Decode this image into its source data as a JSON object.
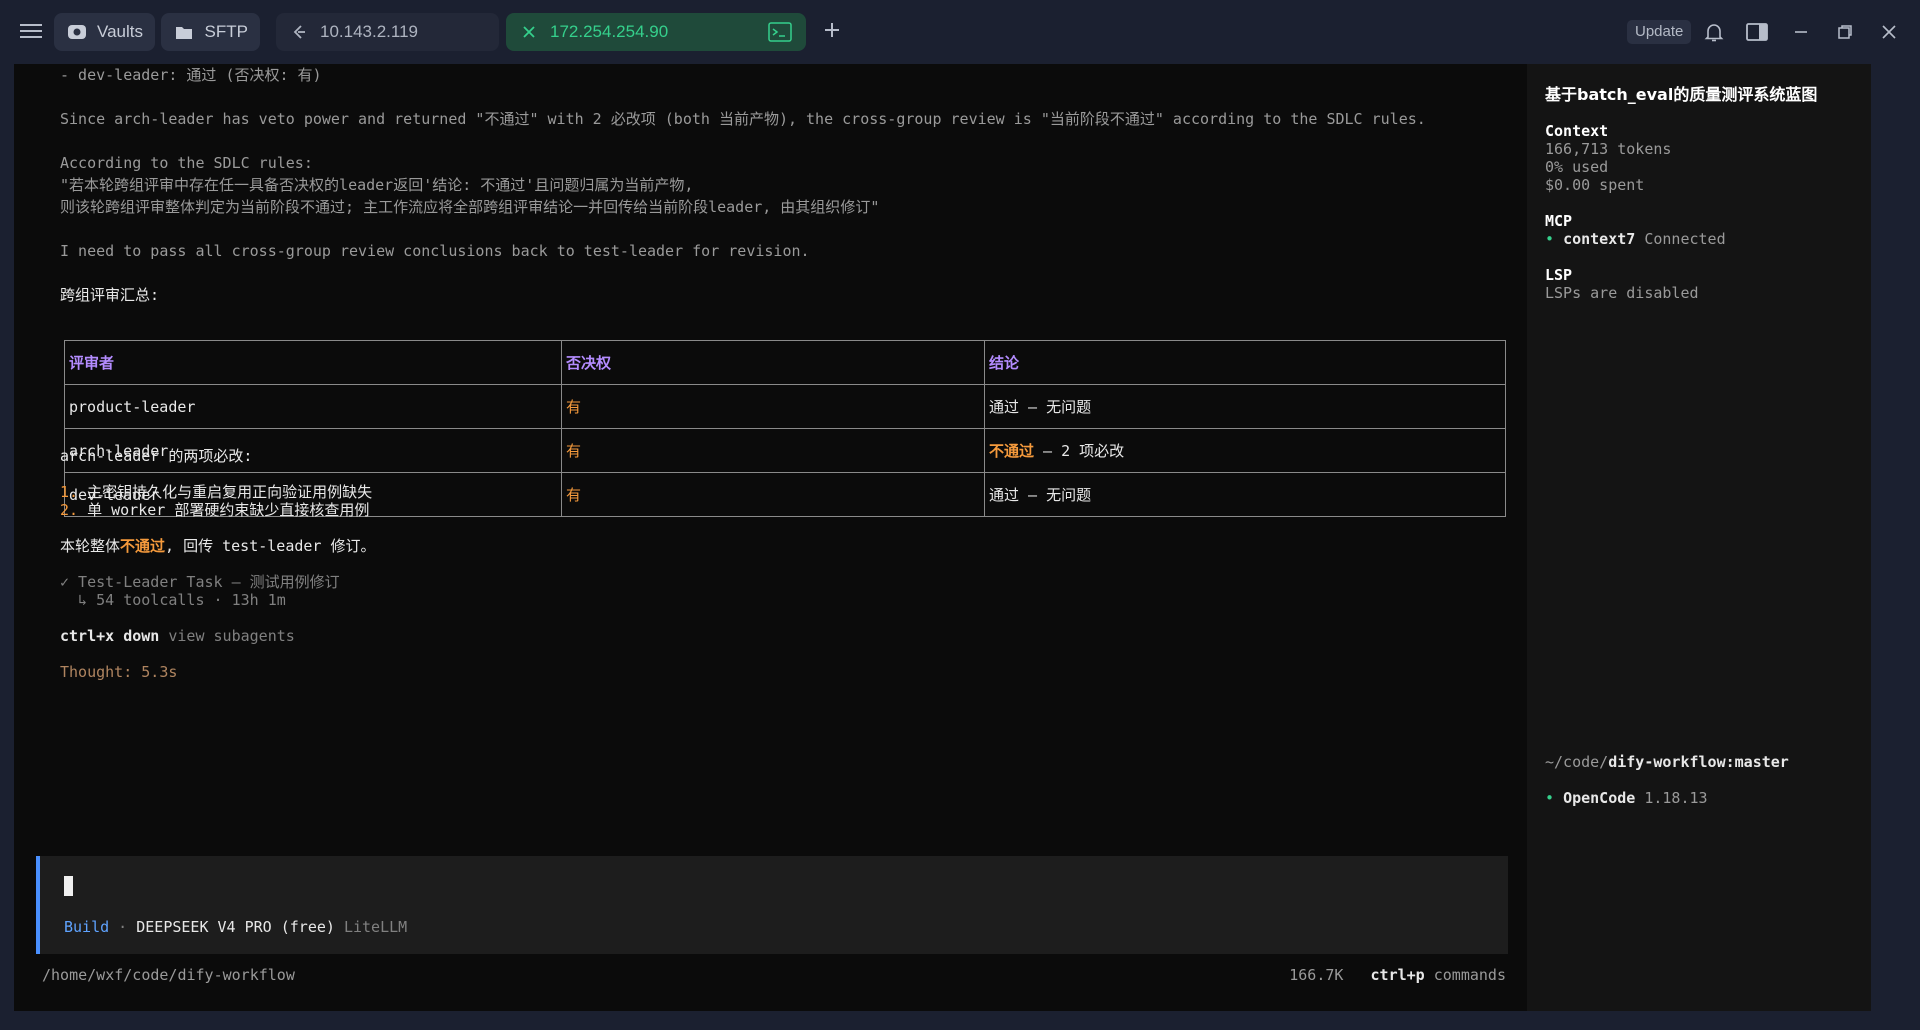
{
  "topbar": {
    "tabs": [
      {
        "label": "Vaults",
        "icon": "vault-icon"
      },
      {
        "label": "SFTP",
        "icon": "folder-icon"
      },
      {
        "label": "10.143.2.119",
        "icon": "host-icon"
      },
      {
        "label": "172.254.254.90",
        "icon": "close-icon"
      }
    ],
    "update_label": "Update"
  },
  "main": {
    "lines": {
      "l1": "- dev-leader: 通过 (否决权: 有)",
      "l2": "Since arch-leader has veto power and returned \"不通过\" with 2 必改项 (both 当前产物), the cross-group review is \"当前阶段不通过\" according to the SDLC rules.",
      "l3": "According to the SDLC rules:",
      "l4": "\"若本轮跨组评审中存在任一具备否决权的leader返回'结论: 不通过'且问题归属为当前产物,",
      "l5": "则该轮跨组评审整体判定为当前阶段不通过; 主工作流应将全部跨组评审结论一并回传给当前阶段leader, 由其组织修订\"",
      "l6": "I need to pass all cross-group review conclusions back to test-leader for revision.",
      "l7": "跨组评审汇总:"
    },
    "table": {
      "headers": [
        "评审者",
        "否决权",
        "结论"
      ],
      "rows": [
        {
          "reviewer": "product-leader",
          "veto": "有",
          "verdict_highlight": "",
          "verdict": "通过 — 无问题"
        },
        {
          "reviewer": "arch-leader",
          "veto": "有",
          "verdict_highlight": "不通过",
          "verdict": " — 2 项必改"
        },
        {
          "reviewer": "dev-leader",
          "veto": "有",
          "verdict_highlight": "",
          "verdict": "通过 — 无问题"
        }
      ]
    },
    "must_fix_title": "arch-leader 的两项必改:",
    "must_fix": [
      {
        "num": "1.",
        "text": " 主密钥持久化与重启复用正向验证用例缺失"
      },
      {
        "num": "2.",
        "text": " 单 worker 部署硬约束缺少直接核查用例"
      }
    ],
    "summary": {
      "pre": "本轮整体",
      "highlight": "不通过",
      "post": ", 回传 test-leader 修订。"
    },
    "task_line": "✓ Test-Leader Task — 测试用例修订",
    "task_sub": "  ↳ 54 toolcalls · 13h 1m",
    "shortcut_key": "ctrl+x down",
    "shortcut_desc": " view subagents",
    "thought": "Thought: 5.3s",
    "input": {
      "mode": "Build",
      "sep": " · ",
      "model": "DEEPSEEK V4 PRO (free)",
      "provider": " LiteLLM"
    },
    "status": {
      "path": "/home/wxf/code/dify-workflow",
      "tokens": "166.7K",
      "cmd_key": "ctrl+p",
      "cmd_label": " commands"
    }
  },
  "sidebar": {
    "title": "基于batch_eval的质量测评系统蓝图",
    "context": {
      "heading": "Context",
      "tokens": "166,713 tokens",
      "used": "0% used",
      "spent": "$0.00 spent"
    },
    "mcp": {
      "heading": "MCP",
      "bullet": "• ",
      "name": "context7",
      "status": " Connected"
    },
    "lsp": {
      "heading": "LSP",
      "status": "LSPs are disabled"
    },
    "branch": {
      "prefix": "~/code/",
      "repo": "dify-workflow:master"
    },
    "version": {
      "bullet": "• ",
      "name": "OpenCode",
      "num": " 1.18.13"
    }
  },
  "colors": {
    "accent_green": "#35d08c",
    "highlight_orange": "#f59a3c",
    "header_purple": "#b48cff",
    "build_blue": "#5fa3ff"
  }
}
